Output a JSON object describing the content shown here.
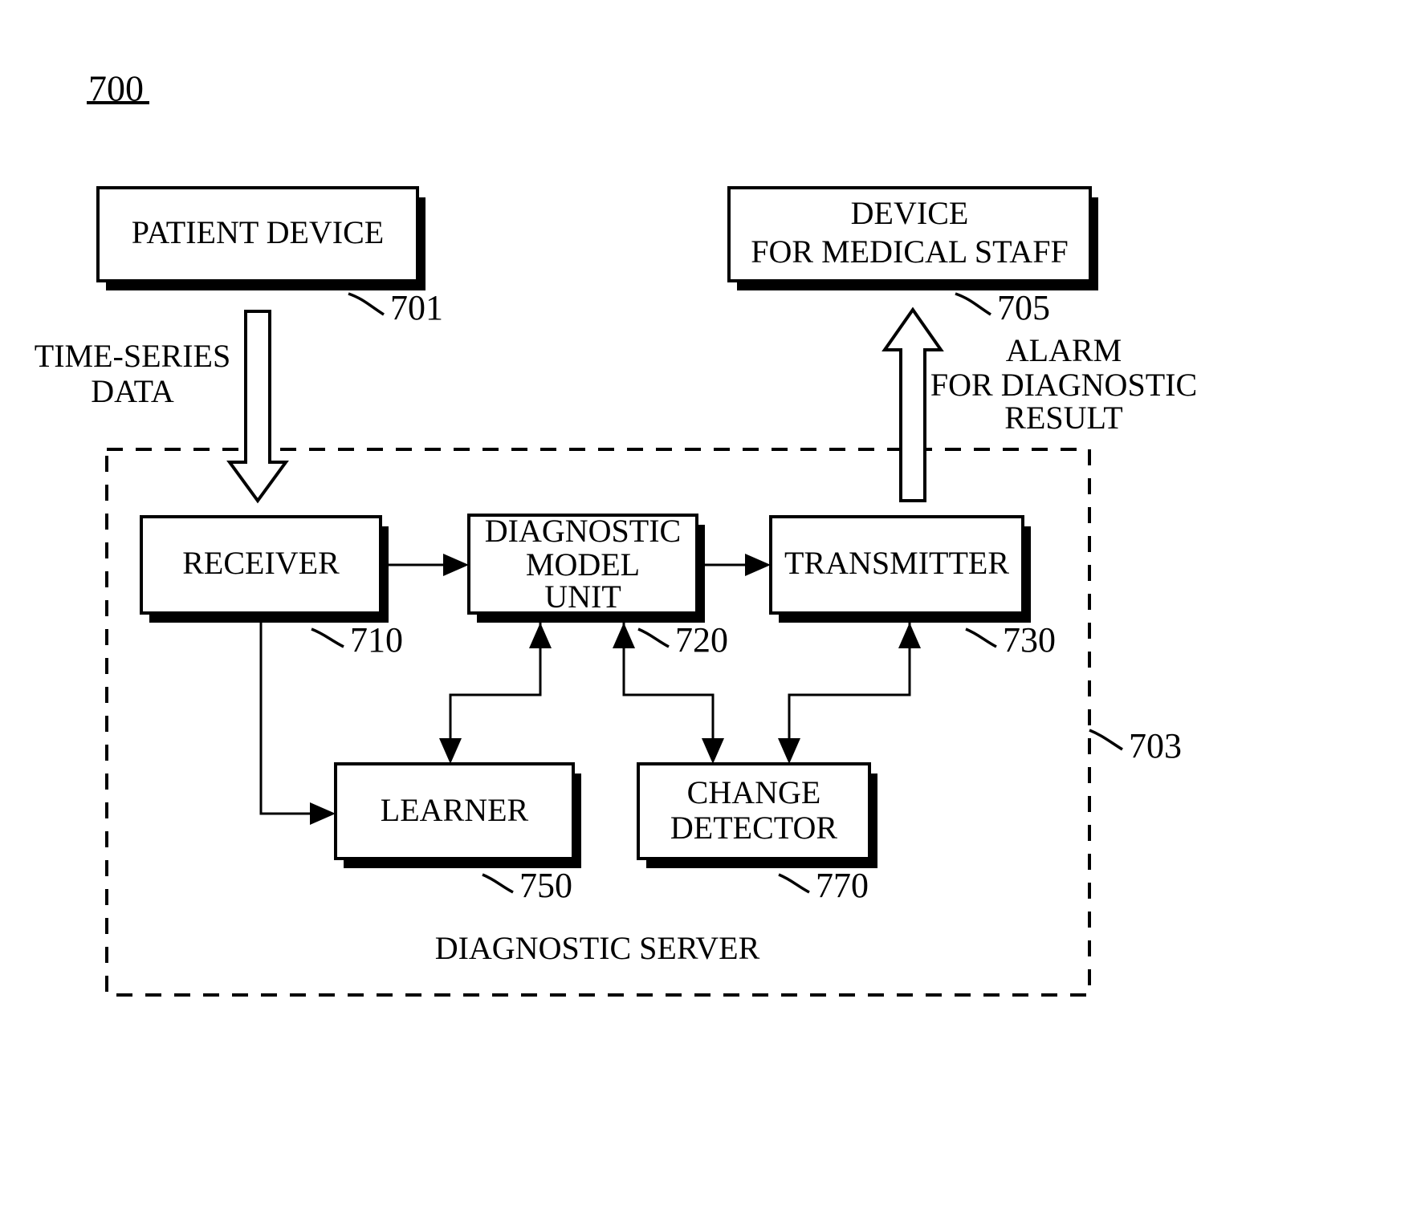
{
  "figure": {
    "number": "700"
  },
  "boxes": {
    "patient_device": {
      "label": "PATIENT DEVICE",
      "ref": "701"
    },
    "device_medical_staff": {
      "label_line1": "DEVICE",
      "label_line2": "FOR MEDICAL STAFF",
      "ref": "705"
    },
    "receiver": {
      "label": "RECEIVER",
      "ref": "710"
    },
    "diagnostic_model_unit": {
      "label_line1": "DIAGNOSTIC",
      "label_line2": "MODEL",
      "label_line3": "UNIT",
      "ref": "720"
    },
    "transmitter": {
      "label": "TRANSMITTER",
      "ref": "730"
    },
    "learner": {
      "label": "LEARNER",
      "ref": "750"
    },
    "change_detector": {
      "label_line1": "CHANGE",
      "label_line2": "DETECTOR",
      "ref": "770"
    }
  },
  "server": {
    "label": "DIAGNOSTIC SERVER",
    "ref": "703"
  },
  "flows": {
    "time_series": {
      "line1": "TIME-SERIES",
      "line2": "DATA"
    },
    "alarm": {
      "line1": "ALARM",
      "line2": "FOR DIAGNOSTIC",
      "line3": "RESULT"
    }
  },
  "colors": {
    "ink": "#000000",
    "paper": "#ffffff"
  }
}
